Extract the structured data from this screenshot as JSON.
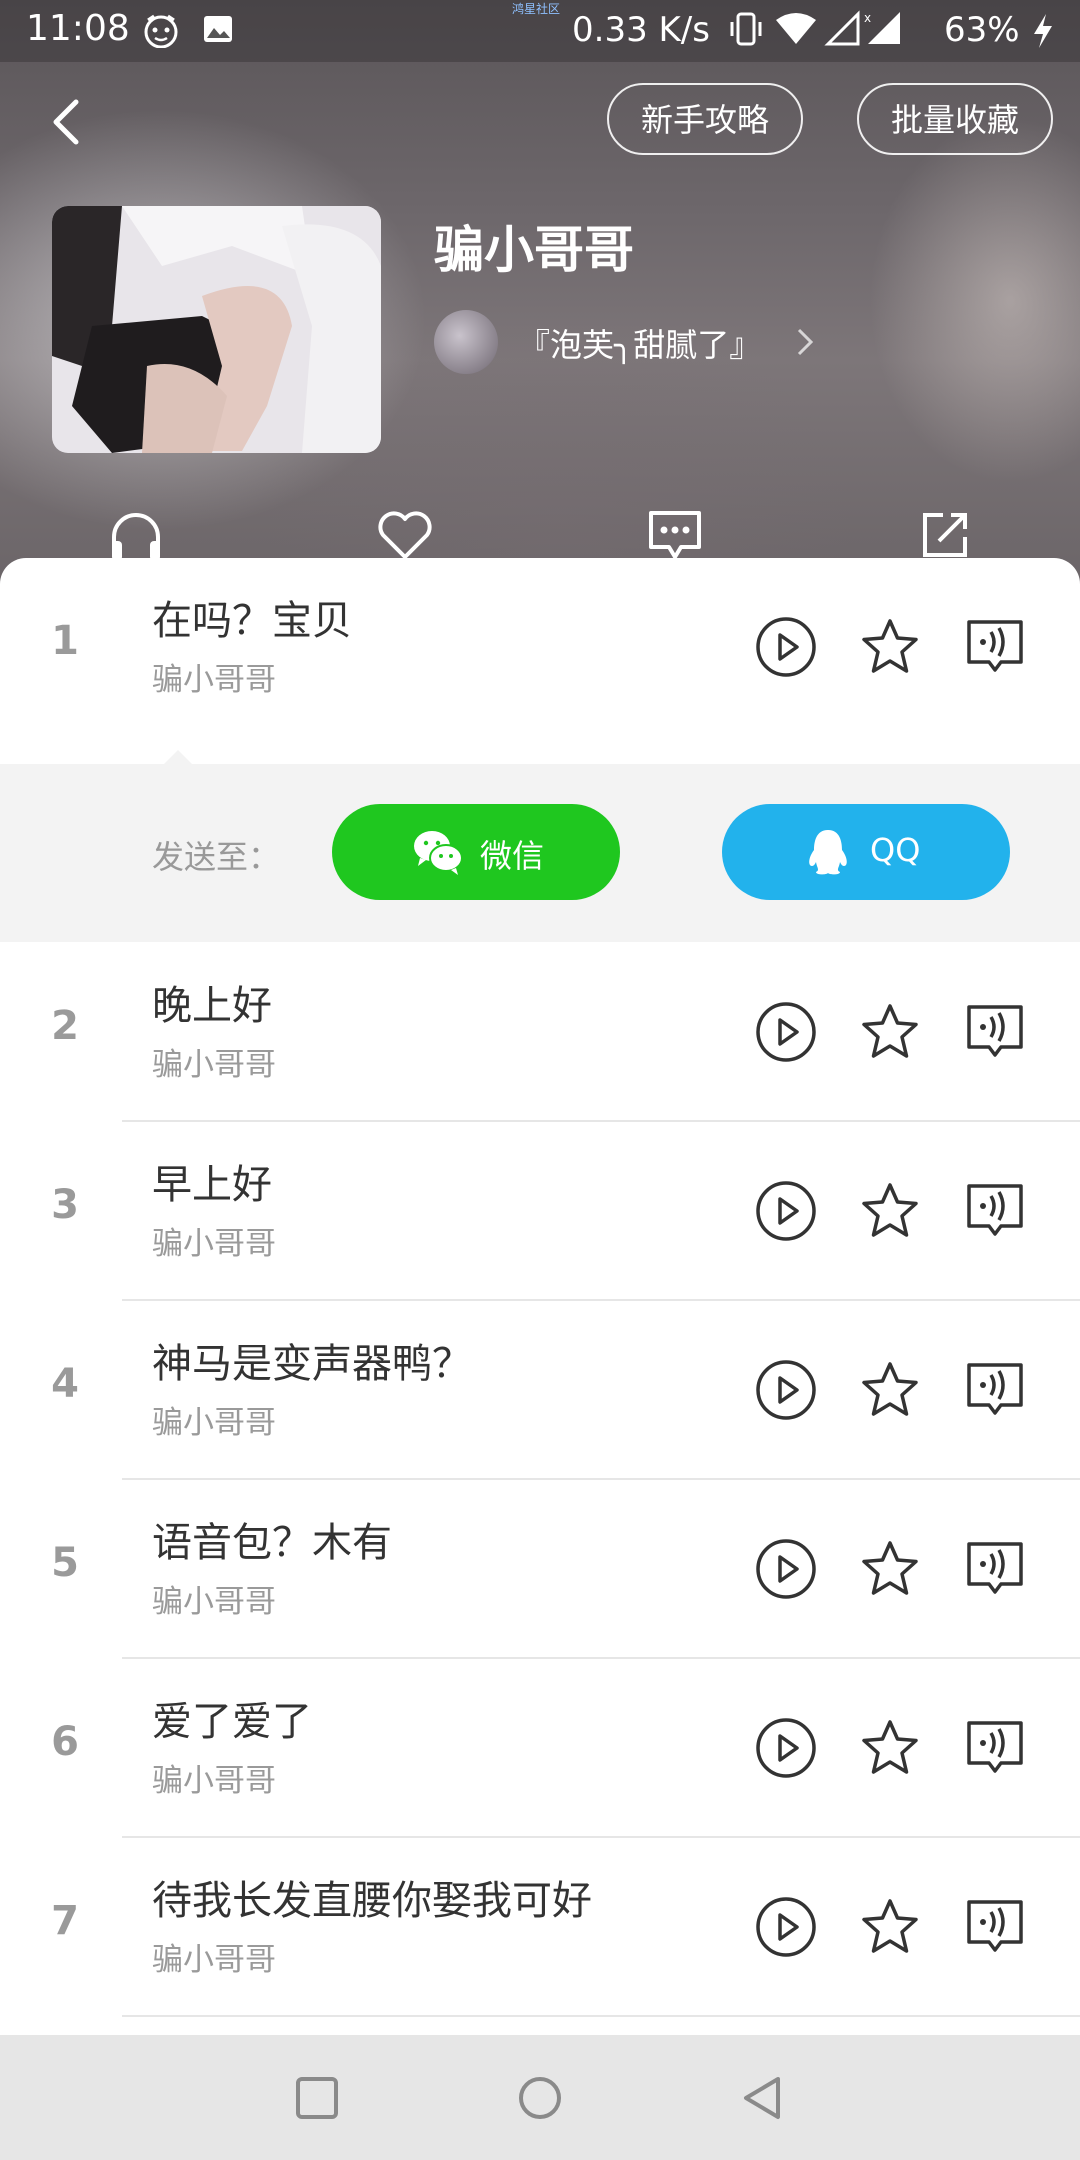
{
  "status_bar": {
    "time": "11:08",
    "watermark": "鸿星社区",
    "net_speed": "0.33 K/s",
    "battery": "63%",
    "icons": [
      "emoji-face-icon",
      "image-icon",
      "vibrate-icon",
      "wifi-icon",
      "signal-icon",
      "signal-x-icon",
      "battery-charging-icon"
    ]
  },
  "header": {
    "guide_label": "新手攻略",
    "batch_label": "批量收藏",
    "album_title": "骗小哥哥",
    "author_name": "『泡芙╮甜腻了』",
    "actions": [
      "headphones-icon",
      "heart-icon",
      "comment-icon",
      "share-icon"
    ]
  },
  "send_panel": {
    "label": "发送至：",
    "wechat_label": "微信",
    "qq_label": "QQ",
    "wechat_color": "#1fc71f",
    "qq_color": "#22b2ec"
  },
  "list": [
    {
      "num": "1",
      "title": "在吗？宝贝",
      "author": "骗小哥哥"
    },
    {
      "num": "2",
      "title": "晚上好",
      "author": "骗小哥哥"
    },
    {
      "num": "3",
      "title": "早上好",
      "author": "骗小哥哥"
    },
    {
      "num": "4",
      "title": "神马是变声器鸭？",
      "author": "骗小哥哥"
    },
    {
      "num": "5",
      "title": "语音包？木有",
      "author": "骗小哥哥"
    },
    {
      "num": "6",
      "title": "爱了爱了",
      "author": "骗小哥哥"
    },
    {
      "num": "7",
      "title": "待我长发直腰你娶我可好",
      "author": "骗小哥哥"
    }
  ],
  "navbar": [
    "recent-apps-icon",
    "home-icon",
    "back-nav-icon"
  ]
}
